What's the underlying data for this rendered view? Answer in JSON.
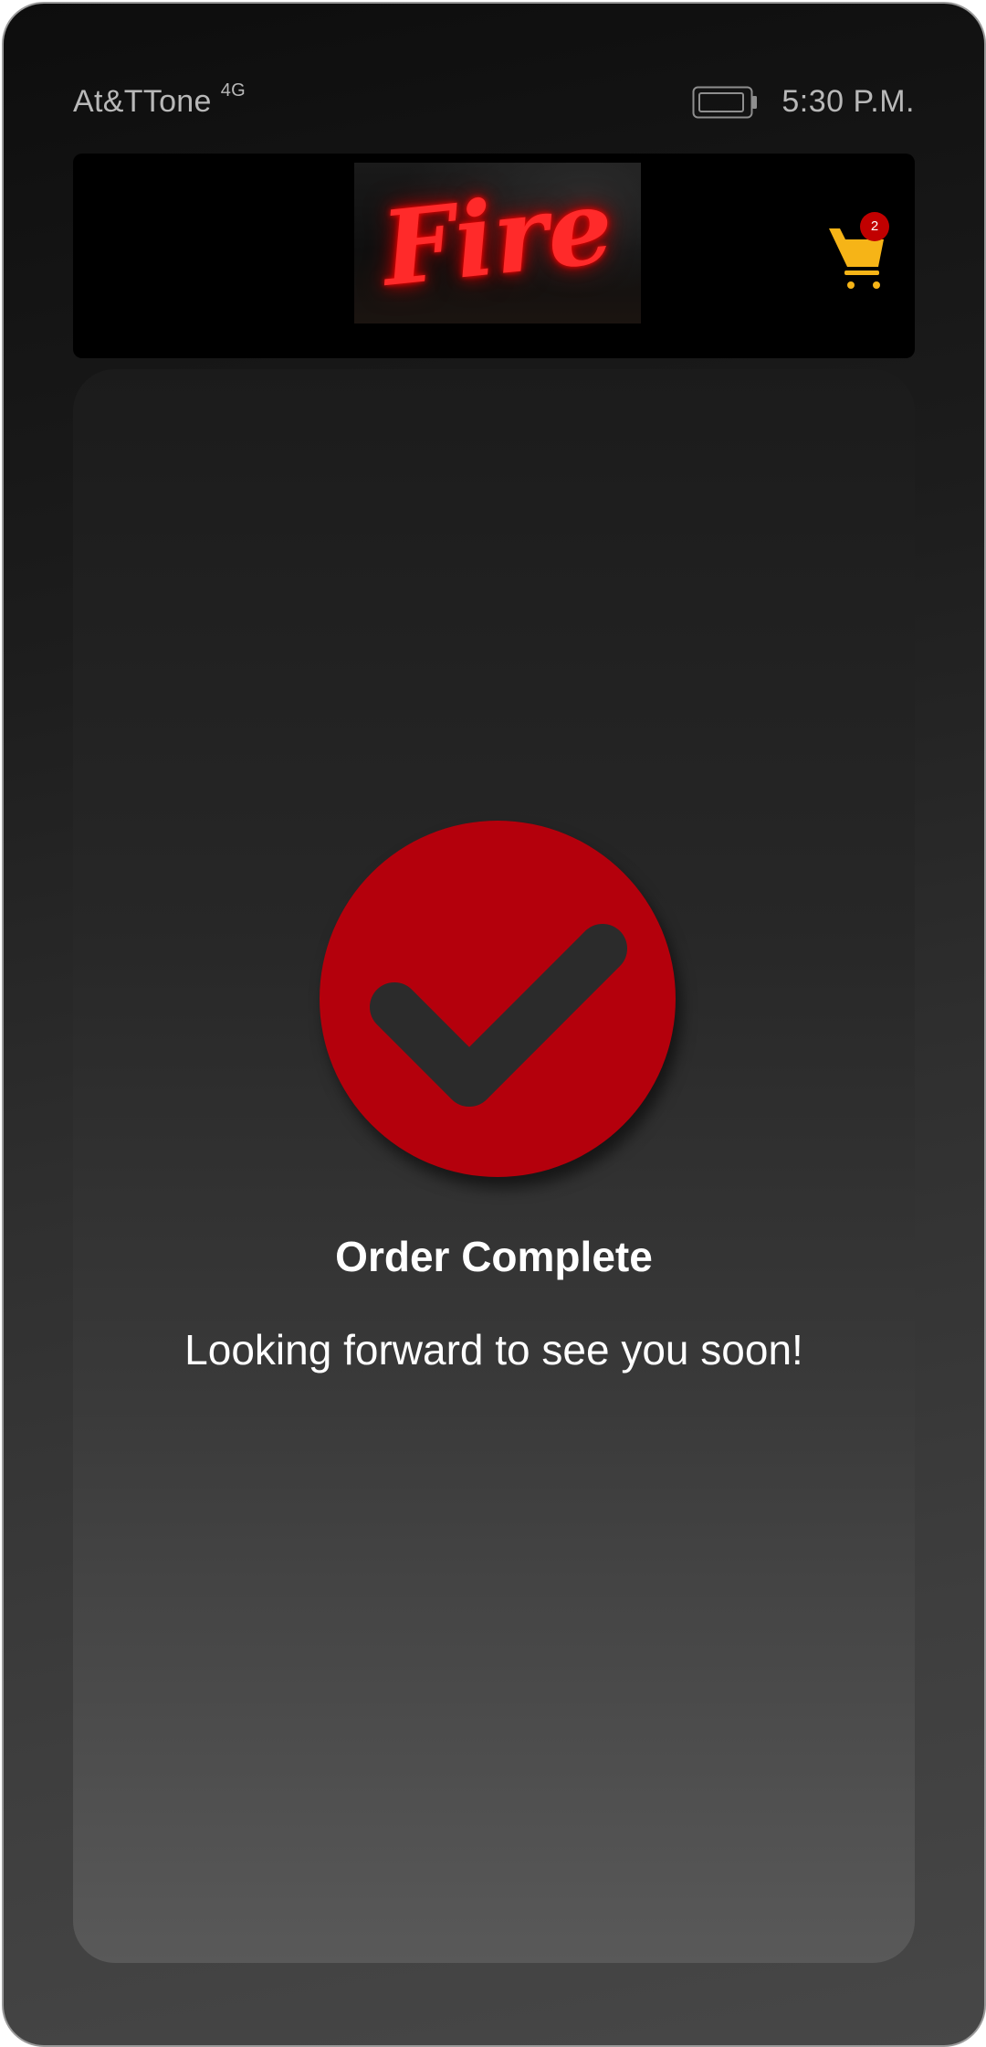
{
  "status_bar": {
    "carrier": "At&TTone",
    "network": "4G",
    "time": "5:30 P.M.",
    "battery_icon": "battery-icon"
  },
  "header": {
    "logo_text": "Fire",
    "cart_icon": "shopping-cart-icon",
    "cart_count": "2"
  },
  "confirmation": {
    "icon": "checkmark-icon",
    "title": "Order Complete",
    "message": "Looking forward to see you soon!"
  },
  "colors": {
    "accent_red": "#b4000c",
    "cart_yellow": "#f6b417",
    "badge_red": "#c10000",
    "neon_red": "#ff2a2a"
  }
}
